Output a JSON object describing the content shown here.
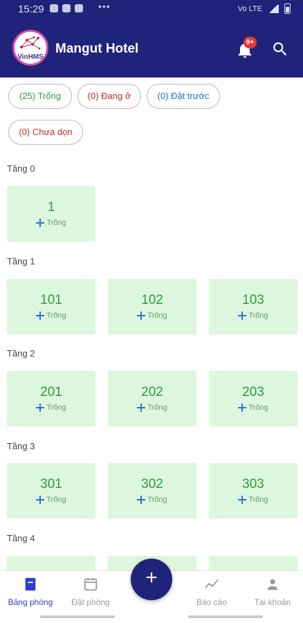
{
  "status_bar": {
    "time": "15:29",
    "dots": "•••",
    "network": "Vo LTE"
  },
  "header": {
    "logo_text": "VinHMS",
    "title": "Mangut Hotel",
    "notification_badge": "9+",
    "background_color": "#1f237a"
  },
  "filters": [
    {
      "label": "(25) Trống",
      "color": "#2e9a3e"
    },
    {
      "label": "(0) Đang ở",
      "color": "#c62828"
    },
    {
      "label": "(0) Đặt trước",
      "color": "#1e6fc8"
    },
    {
      "label": "(0) Chưa dọn",
      "color": "#c62828"
    }
  ],
  "floors": [
    {
      "label": "Tầng 0",
      "rooms": [
        {
          "number": "1",
          "status": "Trống"
        }
      ]
    },
    {
      "label": "Tầng 1",
      "rooms": [
        {
          "number": "101",
          "status": "Trống"
        },
        {
          "number": "102",
          "status": "Trống"
        },
        {
          "number": "103",
          "status": "Trống"
        }
      ]
    },
    {
      "label": "Tầng 2",
      "rooms": [
        {
          "number": "201",
          "status": "Trống"
        },
        {
          "number": "202",
          "status": "Trống"
        },
        {
          "number": "203",
          "status": "Trống"
        }
      ]
    },
    {
      "label": "Tầng 3",
      "rooms": [
        {
          "number": "301",
          "status": "Trống"
        },
        {
          "number": "302",
          "status": "Trống"
        },
        {
          "number": "303",
          "status": "Trống"
        }
      ]
    },
    {
      "label": "Tầng 4",
      "rooms": []
    }
  ],
  "room_color": "#dcf7dd",
  "bottom_nav": {
    "items": [
      {
        "label": "Bảng phòng",
        "icon": "room-board-icon",
        "active": true
      },
      {
        "label": "Đặt phòng",
        "icon": "calendar-icon",
        "active": false
      },
      {
        "label": "Báo cáo",
        "icon": "chart-icon",
        "active": false
      },
      {
        "label": "Tài khoản",
        "icon": "account-icon",
        "active": false
      }
    ],
    "fab_symbol": "+"
  }
}
